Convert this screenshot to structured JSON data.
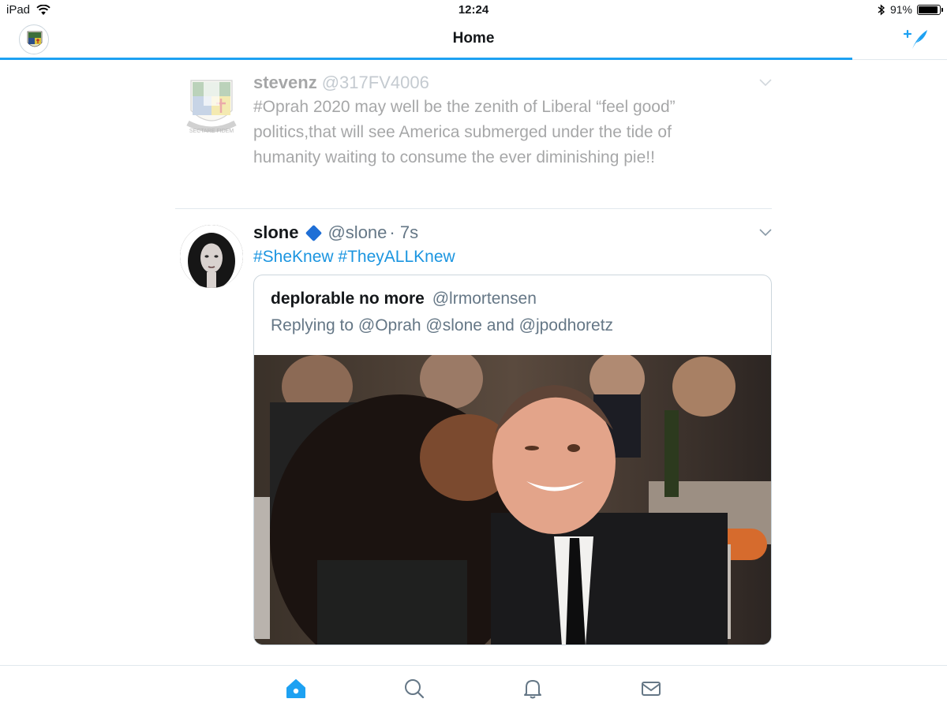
{
  "status_bar": {
    "device": "iPad",
    "time": "12:24",
    "battery_text": "91%",
    "battery_level": 0.91
  },
  "nav": {
    "title": "Home",
    "compose_icon": "compose-quill-icon"
  },
  "tweets": [
    {
      "name": "stevenz",
      "handle": "@317FV4006",
      "text_lines": [
        "#Oprah 2020 may well be the zenith of Liberal  “feel good”",
        "politics,that will see America submerged under the tide of",
        "humanity waiting to consume the ever diminishing pie!!"
      ],
      "avatar_motto": "SECTARE FIDEM"
    },
    {
      "name": "slone",
      "handle": "@slone",
      "time": "· 7s",
      "hashtags": [
        "#SheKnew",
        "#TheyALLKnew"
      ],
      "quote": {
        "name": "deplorable no more",
        "handle": "@lrmortensen",
        "reply": "Replying to @Oprah @slone and @jpodhoretz"
      }
    }
  ],
  "tabs": [
    "home-icon",
    "search-icon",
    "notifications-bell-icon",
    "messages-envelope-icon"
  ],
  "colors": {
    "accent": "#1da1f2",
    "hashtag": "#1b95e0",
    "secondary_text": "#657786",
    "border": "#e1e8ed"
  }
}
